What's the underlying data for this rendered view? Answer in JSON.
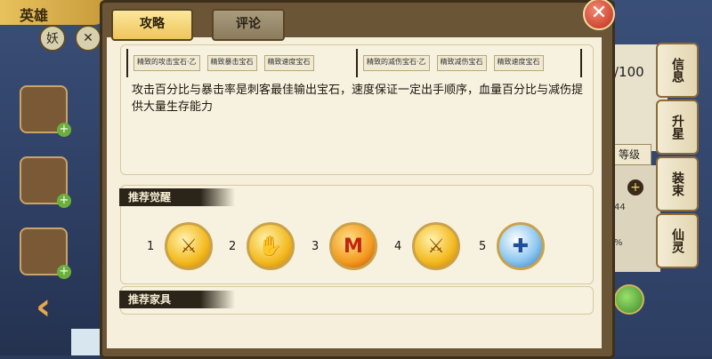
{
  "background": {
    "title_fragment": "英雄",
    "round_buttons": [
      "妖",
      "✕"
    ],
    "count_text": "/100",
    "level_label": "等级",
    "right_small_1": "44",
    "right_small_2": "%",
    "side_tabs": [
      "信息",
      "升星",
      "装束",
      "仙灵"
    ]
  },
  "dialog": {
    "tabs": {
      "active": "攻略",
      "inactive": "评论"
    },
    "close_icon": "close-icon",
    "gem_row_left": [
      "精致的攻击宝石·乙",
      "精致暴击宝石",
      "精致速度宝石"
    ],
    "gem_row_right": [
      "精致的减伤宝石·乙",
      "精致减伤宝石",
      "精致速度宝石"
    ],
    "description": "攻击百分比与暴击率是刺客最佳输出宝石，速度保证一定出手顺序，血量百分比与减伤提供大量生存能力",
    "awaken_section": {
      "label": "推荐觉醒",
      "items": [
        {
          "num": "1",
          "icon": "sword-medal-icon",
          "glyph": "⚔",
          "style": "gold"
        },
        {
          "num": "2",
          "icon": "claw-medal-icon",
          "glyph": "✋",
          "style": "gold"
        },
        {
          "num": "3",
          "icon": "fire-m-medal-icon",
          "glyph": "M",
          "style": "fire"
        },
        {
          "num": "4",
          "icon": "sword-medal-icon",
          "glyph": "⚔",
          "style": "gold"
        },
        {
          "num": "5",
          "icon": "water-cross-medal-icon",
          "glyph": "✚",
          "style": "blue"
        }
      ]
    },
    "furniture_section": {
      "label": "推荐家具"
    }
  }
}
